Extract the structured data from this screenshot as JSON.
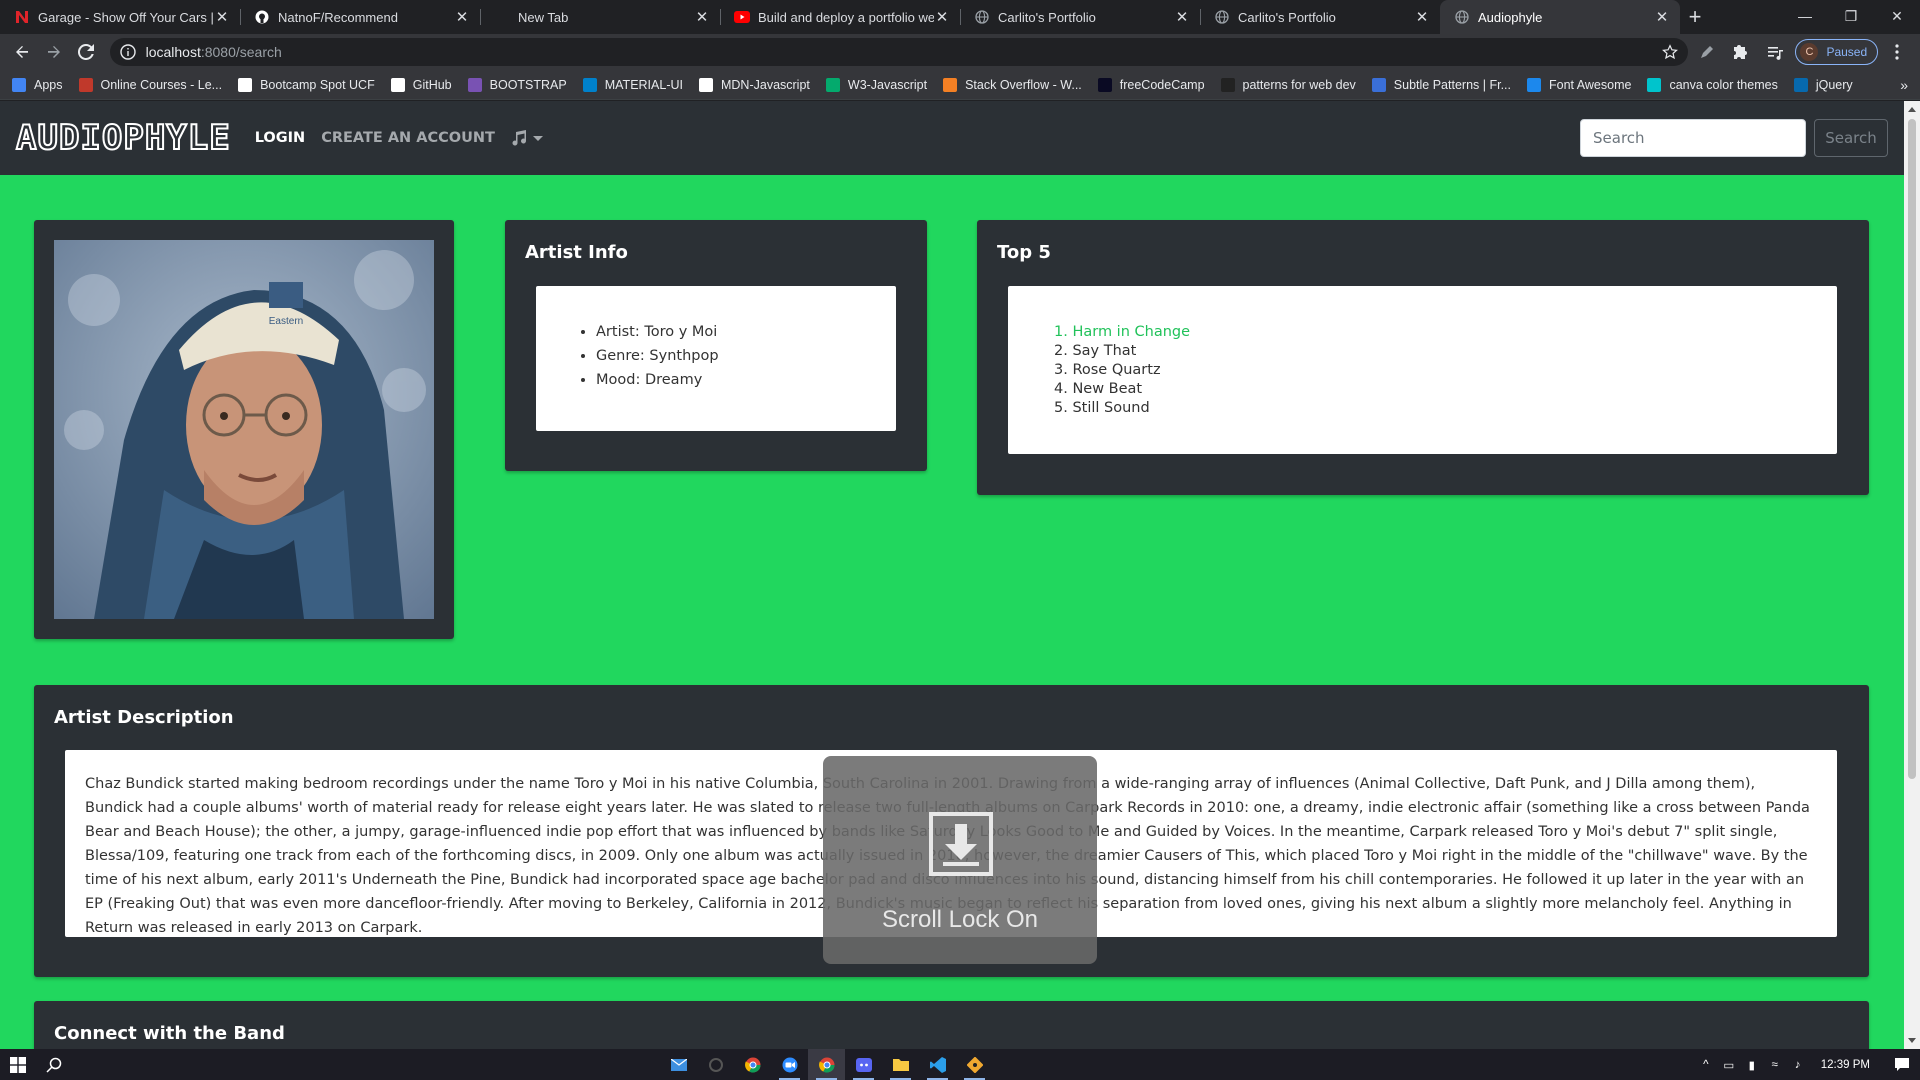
{
  "browser": {
    "tabs": [
      {
        "title": "Garage - Show Off Your Cars | Na",
        "icon": "n-brand-icon",
        "color": "#e0242a"
      },
      {
        "title": "NatnoF/Recommend",
        "icon": "github-icon",
        "color": "#ffffff"
      },
      {
        "title": "New Tab",
        "icon": "",
        "color": ""
      },
      {
        "title": "Build and deploy a portfolio web",
        "icon": "youtube-icon",
        "color": "#ff0000"
      },
      {
        "title": "Carlito's Portfolio",
        "icon": "globe-icon",
        "color": "#9aa0a6"
      },
      {
        "title": "Carlito's Portfolio",
        "icon": "globe-icon",
        "color": "#9aa0a6"
      },
      {
        "title": "Audiophyle",
        "icon": "globe-icon",
        "color": "#9aa0a6"
      }
    ],
    "url_host": "localhost",
    "url_path": ":8080/search",
    "profile_initial": "C",
    "profile_status": "Paused",
    "bookmarks": [
      {
        "label": "Apps",
        "color": "#4285f4"
      },
      {
        "label": "Online Courses - Le...",
        "color": "#c0392b"
      },
      {
        "label": "Bootcamp Spot UCF",
        "color": "#ffffff"
      },
      {
        "label": "GitHub",
        "color": "#ffffff"
      },
      {
        "label": "BOOTSTRAP",
        "color": "#7952b3"
      },
      {
        "label": "MATERIAL-UI",
        "color": "#0081cb"
      },
      {
        "label": "MDN-Javascript",
        "color": "#ffffff"
      },
      {
        "label": "W3-Javascript",
        "color": "#04aa6d"
      },
      {
        "label": "Stack Overflow - W...",
        "color": "#f48024"
      },
      {
        "label": "freeCodeCamp",
        "color": "#0a0a23"
      },
      {
        "label": "patterns for web dev",
        "color": "#222222"
      },
      {
        "label": "Subtle Patterns | Fr...",
        "color": "#3a6fd8"
      },
      {
        "label": "Font Awesome",
        "color": "#1c88ed"
      },
      {
        "label": "canva color themes",
        "color": "#00c4cc"
      },
      {
        "label": "jQuery",
        "color": "#0769ad"
      }
    ]
  },
  "site": {
    "brand": "AUDIOPHYLE",
    "nav": {
      "login": "LOGIN",
      "create": "CREATE AN ACCOUNT"
    },
    "search": {
      "placeholder": "Search",
      "button": "Search"
    },
    "accent": "#21d75e"
  },
  "artist_info": {
    "title": "Artist Info",
    "items": [
      "Artist: Toro y Moi",
      "Genre: Synthpop",
      "Mood: Dreamy"
    ]
  },
  "top5": {
    "title": "Top 5",
    "items": [
      "1. Harm in Change",
      "2. Say That",
      "3. Rose Quartz",
      "4. New Beat",
      "5. Still Sound"
    ]
  },
  "description": {
    "title": "Artist Description",
    "text": "Chaz Bundick started making bedroom recordings under the name Toro y Moi in his native Columbia, South Carolina in 2001. Drawing from a wide-ranging array of influences (Animal Collective, Daft Punk, and J Dilla among them), Bundick had a couple albums' worth of material ready for release eight years later. He was slated to release two full-length albums on Carpark Records in 2010: one, a dreamy, indie electronic affair (something like a cross between Panda Bear and Beach House); the other, a jumpy, garage-influenced indie pop effort that was influenced by bands like Saturday Looks Good to Me and Guided by Voices. In the meantime, Carpark released Toro y Moi's debut 7\" split single, Blessa/109, featuring one track from each of the forthcoming discs, in 2009. Only one album was actually issued in 2010, however, the dreamier Causers of This, which placed Toro y Moi right in the middle of the \"chillwave\" wave. By the time of his next album, early 2011's Underneath the Pine, Bundick had incorporated space age bachelor pad and disco influences into his sound, distancing himself from his chill contemporaries. He followed it up later in the year with an EP (Freaking Out) that was even more dancefloor-friendly. After moving to Berkeley, California in 2012, Bundick's music began to reflect his separation from loved ones, giving his next album a slightly more melancholy feel. Anything in Return was released in early 2013 on Carpark."
  },
  "connect": {
    "title": "Connect with the Band"
  },
  "osd": {
    "text": "Scroll Lock On"
  },
  "taskbar": {
    "time": "12:39 PM"
  }
}
